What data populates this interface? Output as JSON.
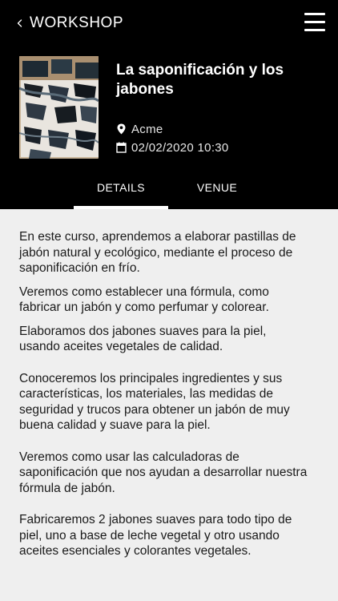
{
  "topbar": {
    "title": "WORKSHOP",
    "back_icon": "chevron-left-icon",
    "menu_icon": "hamburger-menu-icon"
  },
  "event": {
    "title": "La saponificación y los jabones",
    "location": "Acme",
    "datetime": "02/02/2020 10:30",
    "location_icon": "location-pin-icon",
    "date_icon": "calendar-icon"
  },
  "tabs": [
    {
      "label": "DETAILS",
      "active": true
    },
    {
      "label": "VENUE",
      "active": false
    }
  ],
  "details": {
    "paragraphs": [
      "En este curso, aprendemos a elaborar pastillas de jabón natural y ecológico, mediante el proceso de saponificación en frío.",
      "Veremos como establecer una fórmula, como fabricar un jabón y como perfumar y colorear.",
      "Elaboramos dos jabones suaves para la piel, usando aceites vegetales de calidad.",
      "Conoceremos los principales ingredientes y sus características, los materiales, las medidas de seguridad y trucos para obtener un jabón de muy buena calidad y suave para la piel.",
      "Veremos como usar las calculadoras de saponificación que nos ayudan a desarrollar nuestra fórmula de jabón.",
      "Fabricaremos 2 jabones suaves para todo tipo de piel, uno a base de leche vegetal y otro usando aceites esenciales y colorantes vegetales."
    ]
  },
  "colors": {
    "header_bg": "#000000",
    "content_bg": "#efefef",
    "text": "#1a1a1a"
  }
}
